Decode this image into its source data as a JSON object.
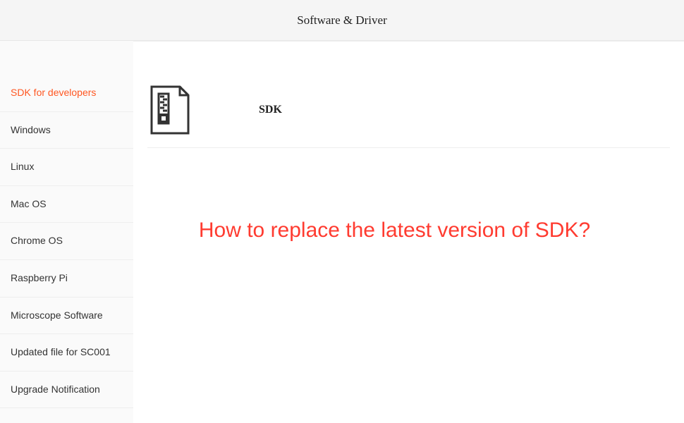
{
  "header": {
    "title": "Software & Driver"
  },
  "sidebar": {
    "items": [
      {
        "label": "SDK for developers",
        "active": true
      },
      {
        "label": "Windows",
        "active": false
      },
      {
        "label": "Linux",
        "active": false
      },
      {
        "label": "Mac OS",
        "active": false
      },
      {
        "label": "Chrome OS",
        "active": false
      },
      {
        "label": "Raspberry Pi",
        "active": false
      },
      {
        "label": "Microscope Software",
        "active": false
      },
      {
        "label": "Updated file for SC001",
        "active": false
      },
      {
        "label": "Upgrade Notification",
        "active": false
      }
    ]
  },
  "main": {
    "file_title": "SDK",
    "question": "How to replace the latest version of SDK?"
  }
}
